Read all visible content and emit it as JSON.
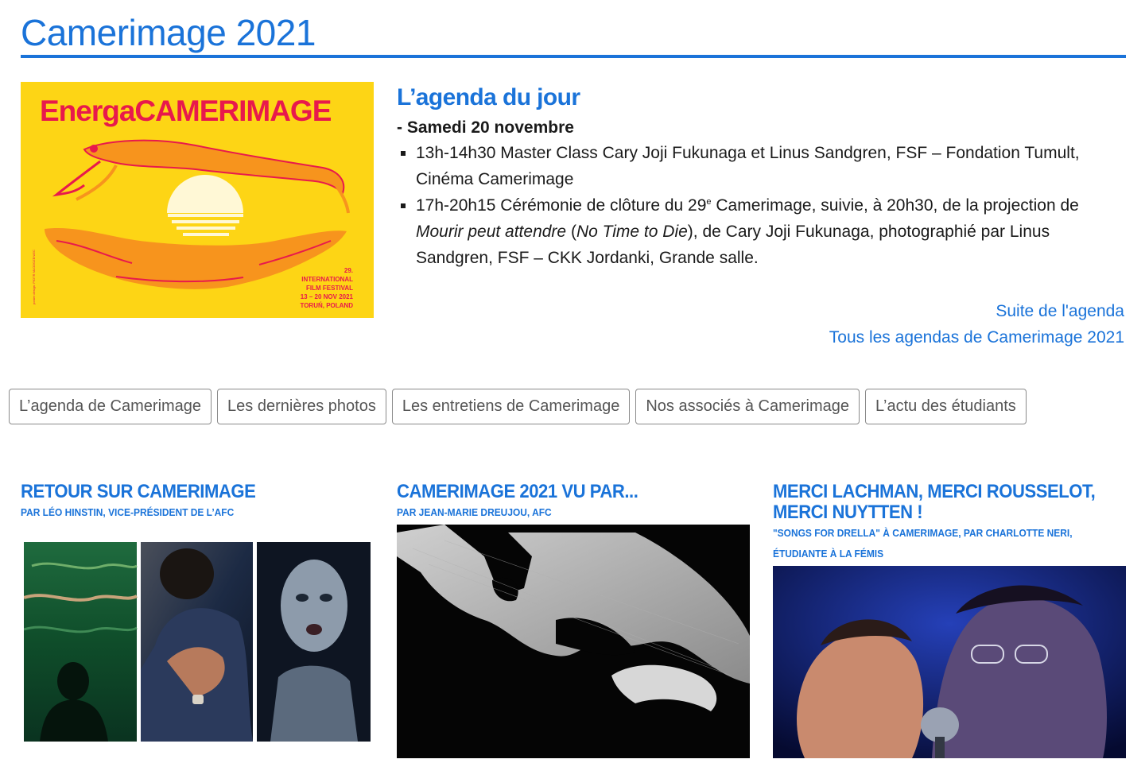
{
  "header": {
    "title": "Camerimage 2021"
  },
  "poster": {
    "logo": "EnergaCAMERIMAGE",
    "info": [
      "29.",
      "INTERNATIONAL",
      "FILM FESTIVAL",
      "13 – 20 NOV 2021",
      "TORUŃ, POLAND"
    ],
    "credit": "poster design: PIOTR MLODOZENIEC",
    "colors": {
      "background": "#fdd515",
      "accent": "#e8194c",
      "orange": "#f7941d"
    }
  },
  "agenda": {
    "heading": "L’agenda du jour",
    "date": "- Samedi 20 novembre",
    "items": [
      {
        "text": "13h-14h30 Master Class Cary Joji Fukunaga et Linus Sandgren, FSF – Fondation Tumult, Cinéma Camerimage"
      },
      {
        "part1": "17h-20h15 Cérémonie de clôture du 29",
        "sup": "e",
        "part2": " Camerimage, suivie, à 20h30, de la projection de ",
        "italic1": "Mourir peut attendre",
        "part3": " (",
        "italic2": "No Time to Die",
        "part4": "), de Cary Joji Fukunaga, photographié par Linus Sandgren, FSF – CKK Jordanki, Grande salle."
      }
    ],
    "links": {
      "more": "Suite de l'agenda",
      "all": "Tous les agendas de Camerimage 2021"
    }
  },
  "tabs": [
    "L’agenda de Camerimage",
    "Les dernières photos",
    "Les entretiens de Camerimage",
    "Nos associés à Camerimage",
    "L’actu des étudiants"
  ],
  "articles": [
    {
      "title": "RETOUR SUR CAMERIMAGE",
      "subtitle": "PAR LÉO HINSTIN, VICE-PRÉSIDENT DE L’AFC"
    },
    {
      "title": "CAMERIMAGE 2021 VU PAR...",
      "subtitle": "PAR JEAN-MARIE DREUJOU, AFC"
    },
    {
      "title_line1": "MERCI LACHMAN, MERCI ROUSSELOT,",
      "title_line2": "MERCI NUYTTEN !",
      "subtitle_line1": "\"SONGS FOR DRELLA\" À CAMERIMAGE, PAR CHARLOTTE NERI,",
      "subtitle_line2": "ÉTUDIANTE À LA FÉMIS"
    }
  ],
  "colors": {
    "accent": "#1a73d9",
    "text": "#1a1a1a",
    "tab_text": "#555555"
  }
}
